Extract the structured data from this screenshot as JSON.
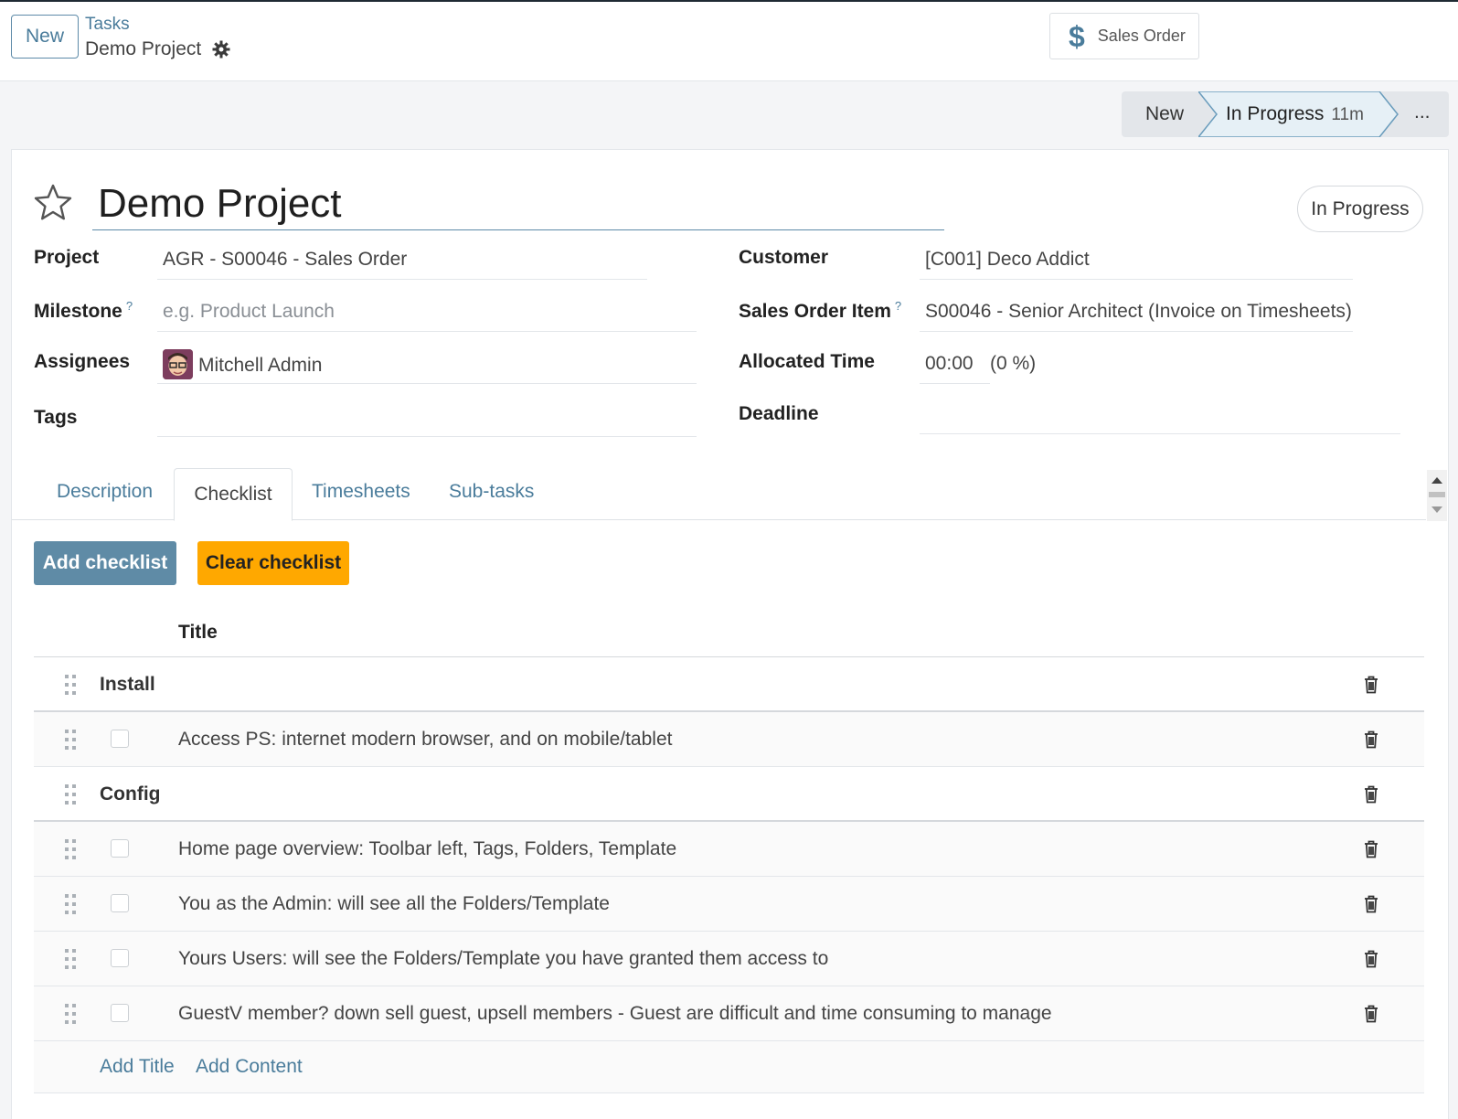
{
  "control_panel": {
    "new_button": "New",
    "breadcrumb_parent": "Tasks",
    "breadcrumb_current": "Demo Project",
    "smart_button": "Sales Order"
  },
  "statusbar": {
    "stage_new": "New",
    "stage_current": "In Progress",
    "stage_current_duration": "11m",
    "more": "..."
  },
  "record": {
    "title": "Demo Project",
    "state": "In Progress"
  },
  "fields": {
    "project_label": "Project",
    "project_value": "AGR - S00046 - Sales Order",
    "milestone_label": "Milestone",
    "milestone_help": "?",
    "milestone_placeholder": "e.g. Product Launch",
    "assignees_label": "Assignees",
    "assignees_value": "Mitchell Admin",
    "tags_label": "Tags",
    "customer_label": "Customer",
    "customer_value": "[C001] Deco Addict",
    "sales_order_item_label": "Sales Order Item",
    "sales_order_item_help": "?",
    "sales_order_item_value": "S00046 - Senior Architect (Invoice on Timesheets)",
    "allocated_time_label": "Allocated Time",
    "allocated_time_value": "00:00",
    "allocated_time_percent": "(0 %)",
    "deadline_label": "Deadline"
  },
  "tabs": [
    "Description",
    "Checklist",
    "Timesheets",
    "Sub-tasks"
  ],
  "checklist": {
    "add_button": "Add checklist",
    "clear_button": "Clear checklist",
    "column_title": "Title",
    "rows": [
      {
        "type": "section",
        "text": "Install"
      },
      {
        "type": "item",
        "text": "Access PS: internet modern browser, and on mobile/tablet"
      },
      {
        "type": "section",
        "text": "Config"
      },
      {
        "type": "item",
        "text": "Home page overview: Toolbar left, Tags, Folders, Template"
      },
      {
        "type": "item",
        "text": "You as the Admin: will see all the Folders/Template"
      },
      {
        "type": "item",
        "text": "Yours Users: will see the Folders/Template you have granted them access to"
      },
      {
        "type": "item",
        "text": "GuestV member? down sell guest, upsell members - Guest are difficult and time consuming to manage"
      }
    ],
    "add_title": "Add Title",
    "add_content": "Add Content"
  },
  "colors": {
    "accent": "#5f8ba6",
    "link": "#4a7c9b",
    "warning": "#ffa800"
  }
}
